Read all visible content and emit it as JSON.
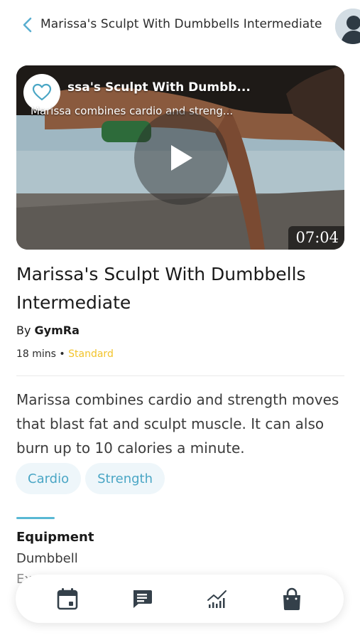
{
  "header": {
    "title": "Marissa's Sculpt With Dumbbells Intermediate",
    "back_icon": "chevron-left-icon",
    "avatar_icon": "user-avatar-icon"
  },
  "video": {
    "title": "ssa's Sculpt With Dumbb...",
    "subtitle": "Marissa combines cardio and streng...",
    "duration": "07:04",
    "favorite_icon": "heart-icon",
    "play_icon": "play-icon"
  },
  "workout": {
    "title": "Marissa's Sculpt With Dumbbells Intermediate",
    "by_prefix": "By ",
    "author": "GymRa",
    "duration": "18 mins",
    "separator": " • ",
    "level": "Standard",
    "description": "Marissa combines cardio and strength moves that blast fat and sculpt muscle. It can also burn up to 10 calories a minute."
  },
  "tags": [
    "Cardio",
    "Strength"
  ],
  "equipment": {
    "label": "Equipment",
    "value": "Dumbbell",
    "extra": "Ex"
  },
  "bottom_nav": {
    "items": [
      "calendar-icon",
      "chat-icon",
      "stats-chart-icon",
      "shopping-bag-icon"
    ]
  },
  "colors": {
    "accent": "#59b8d4",
    "tag_bg": "#eef6fa",
    "tag_text": "#4aa6c5",
    "level": "#f2c32a",
    "icon_dark": "#34404a"
  }
}
